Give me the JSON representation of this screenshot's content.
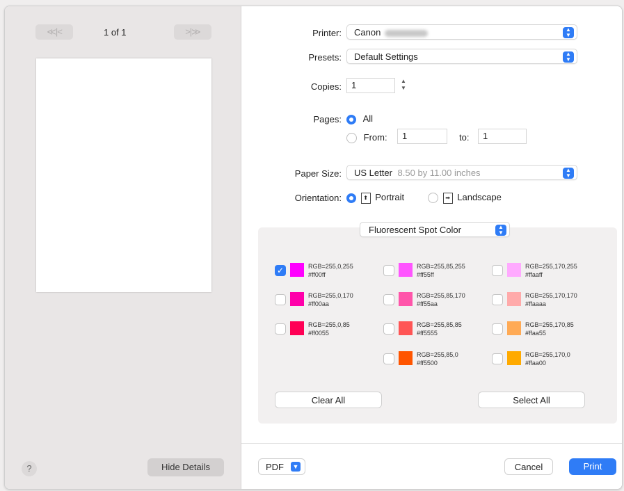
{
  "preview": {
    "page_count": "1 of 1",
    "prev_label": "≪|<",
    "next_label": ">|≫",
    "help_label": "?",
    "hide_details_label": "Hide Details"
  },
  "printer": {
    "label": "Printer:",
    "value": "Canon"
  },
  "presets": {
    "label": "Presets:",
    "value": "Default Settings"
  },
  "copies": {
    "label": "Copies:",
    "value": "1"
  },
  "pages": {
    "label": "Pages:",
    "all_label": "All",
    "from_label": "From:",
    "from_value": "1",
    "to_label": "to:",
    "to_value": "1",
    "selected": "All"
  },
  "paper_size": {
    "label": "Paper Size:",
    "value": "US Letter",
    "detail": "8.50 by 11.00 inches"
  },
  "orientation": {
    "label": "Orientation:",
    "portrait_label": "Portrait",
    "landscape_label": "Landscape",
    "selected": "Portrait"
  },
  "section_popup": "Fluorescent Spot Color",
  "swatches": [
    {
      "rgb": "RGB=255,0,255",
      "hex": "#ff00ff",
      "checked": true
    },
    {
      "rgb": "RGB=255,85,255",
      "hex": "#ff55ff",
      "checked": false
    },
    {
      "rgb": "RGB=255,170,255",
      "hex": "#ffaaff",
      "checked": false
    },
    {
      "rgb": "RGB=255,0,170",
      "hex": "#ff00aa",
      "checked": false
    },
    {
      "rgb": "RGB=255,85,170",
      "hex": "#ff55aa",
      "checked": false
    },
    {
      "rgb": "RGB=255,170,170",
      "hex": "#ffaaaa",
      "checked": false
    },
    {
      "rgb": "RGB=255,0,85",
      "hex": "#ff0055",
      "checked": false
    },
    {
      "rgb": "RGB=255,85,85",
      "hex": "#ff5555",
      "checked": false
    },
    {
      "rgb": "RGB=255,170,85",
      "hex": "#ffaa55",
      "checked": false
    },
    {
      "rgb": "RGB=255,85,0",
      "hex": "#ff5500",
      "checked": false
    },
    {
      "rgb": "RGB=255,170,0",
      "hex": "#ffaa00",
      "checked": false
    }
  ],
  "buttons": {
    "clear_all": "Clear All",
    "select_all": "Select All",
    "pdf": "PDF",
    "cancel": "Cancel",
    "print": "Print"
  },
  "colors": {
    "accent": "#2f7cf6"
  }
}
